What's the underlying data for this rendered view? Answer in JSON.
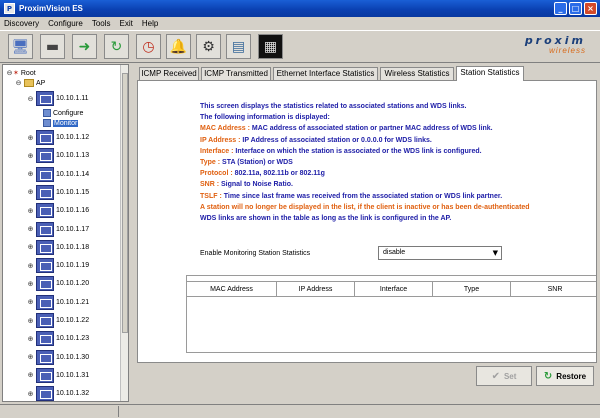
{
  "window": {
    "title": "ProximVision ES",
    "controls": [
      "_",
      "□",
      "×"
    ]
  },
  "menu": [
    "Discovery",
    "Configure",
    "Tools",
    "Exit",
    "Help"
  ],
  "toolbar": {
    "buttons": [
      "discover-icon",
      "disk-icon",
      "forward-arrow-icon",
      "refresh-icon",
      "scheduler-icon",
      "alarm-bell-icon",
      "settings-icon",
      "report-icon",
      "monitor-icon"
    ]
  },
  "logo": {
    "main": "proxim",
    "sub": "wireless"
  },
  "tree": {
    "root": "Root",
    "ap": "AP",
    "selected_ip": "10.10.1.11",
    "children": [
      "Configure",
      "Monitor"
    ],
    "nodes": [
      "10.10.1.12",
      "10.10.1.13",
      "10.10.1.14",
      "10.10.1.15",
      "10.10.1.16",
      "10.10.1.17",
      "10.10.1.18",
      "10.10.1.19",
      "10.10.1.20",
      "10.10.1.21",
      "10.10.1.22",
      "10.10.1.23",
      "10.10.1.30",
      "10.10.1.31",
      "10.10.1.32"
    ]
  },
  "tabs": [
    "ICMP Received",
    "ICMP Transmitted",
    "Ethernet Interface Statistics",
    "Wireless Statistics",
    "Station Statistics"
  ],
  "active_tab": "Station Statistics",
  "info": {
    "line1": "This screen displays the statistics related to associated stations and WDS links.",
    "line2": "The following information is displayed:",
    "mac_key": "MAC Address : ",
    "mac_val": "MAC address of associated station or partner MAC address of WDS link.",
    "ip_key": "IP Address : ",
    "ip_val": "IP Address of associated station or 0.0.0.0 for WDS links.",
    "iface_key": "Interface : ",
    "iface_val": "Interface on which the station is associated or the WDS link is configured.",
    "type_key": "Type : ",
    "type_val": "STA (Station) or WDS",
    "proto_key": "Protocol : ",
    "proto_val": "802.11a, 802.11b or 802.11g",
    "snr_key": "SNR : ",
    "snr_val": "Signal to Noise Ratio.",
    "tslf_key": "TSLF : ",
    "tslf_val": "Time since last frame was received from the associated station or WDS link partner.",
    "warning": "A station will no longer be displayed in the list, if the client is inactive or has been de-authenticated",
    "wds_note": "WDS links are shown in the table as long as the link is configured in the AP."
  },
  "monitor": {
    "label": "Enable Monitoring Station Statistics",
    "value": "disable"
  },
  "table": {
    "columns": [
      "MAC Address",
      "IP Address",
      "Interface",
      "Type",
      "SNR"
    ]
  },
  "buttons": {
    "set": "Set",
    "restore": "Restore"
  },
  "colors": {
    "info_blue": "#2020a8",
    "info_orange": "#e06010",
    "titlebar": "#0a3fb0"
  }
}
